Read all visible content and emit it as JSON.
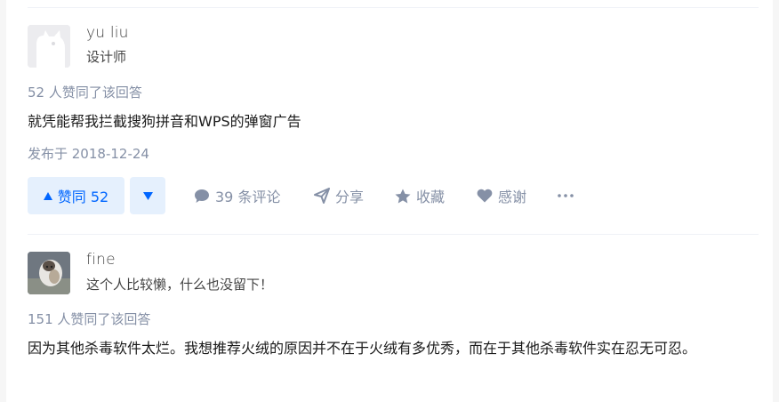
{
  "answers": [
    {
      "author": {
        "name": "yu liu",
        "bio": "设计师"
      },
      "votes_text": "52 人赞同了该回答",
      "content": "就凭能帮我拦截搜狗拼音和WPS的弹窗广告",
      "published": "发布于 2018-12-24",
      "actions": {
        "upvote_label": "赞同 52",
        "comments": "39 条评论",
        "share": "分享",
        "favorite": "收藏",
        "thanks": "感谢"
      }
    },
    {
      "author": {
        "name": "fine",
        "bio": "这个人比较懒，什么也没留下！"
      },
      "votes_text": "151 人赞同了该回答",
      "content": "因为其他杀毒软件太烂。我想推荐火绒的原因并不在于火绒有多优秀，而在于其他杀毒软件实在忍无可忍。"
    }
  ],
  "colors": {
    "accent": "#0066ff",
    "accent_bg": "#e5f0fd",
    "meta": "#8590a6"
  },
  "icons": [
    "comment-icon",
    "share-icon",
    "star-icon",
    "heart-icon",
    "more-icon",
    "upvote-icon",
    "downvote-icon"
  ]
}
